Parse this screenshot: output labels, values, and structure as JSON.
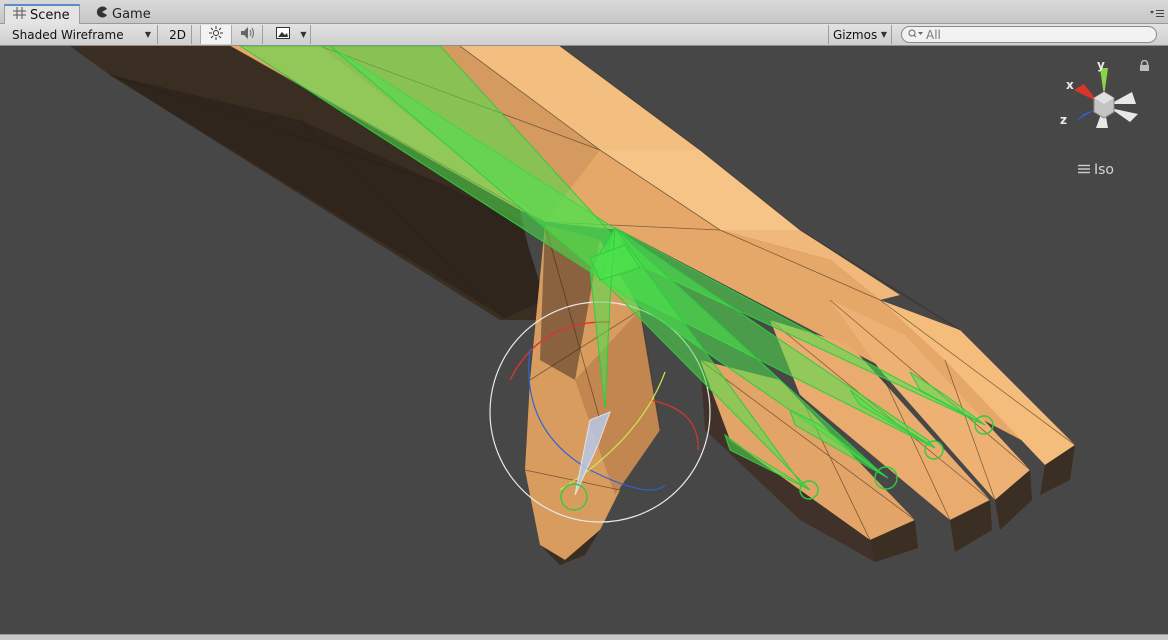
{
  "tabs": [
    {
      "label": "Scene",
      "icon": "grid-icon",
      "active": true
    },
    {
      "label": "Game",
      "icon": "pacman-icon",
      "active": false
    }
  ],
  "toolbar": {
    "draw_mode": "Shaded Wireframe",
    "mode_2d": "2D",
    "gizmos": "Gizmos",
    "search_placeholder": "All"
  },
  "orientation_gizmo": {
    "axes": {
      "x": "x",
      "y": "y",
      "z": "z"
    },
    "projection": "Iso",
    "colors": {
      "x": "#d8352c",
      "y": "#8bd44a",
      "z": "#2f63d6"
    }
  },
  "colors": {
    "viewport_bg": "#474747",
    "mesh_light": "#f0b97a",
    "mesh_dark": "#3b2e22",
    "bone": "#4de24d"
  }
}
